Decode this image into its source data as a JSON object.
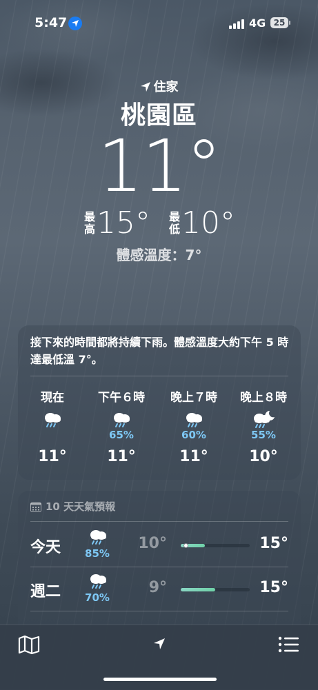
{
  "status_bar": {
    "time": "5:47",
    "network": "4G",
    "battery": "25"
  },
  "location": {
    "label": "住家",
    "city": "桃園區"
  },
  "current": {
    "temperature": "11°",
    "high_label": "最高",
    "high": "15°",
    "low_label": "最低",
    "low": "10°",
    "feels_like": "體感溫度：7°"
  },
  "hourly": {
    "summary": "接下來的時間都將持續下雨。體感溫度大約下午 5 時達最低溫 7°。",
    "items": [
      {
        "label": "現在",
        "icon": "rain-cloud-icon",
        "precip": "",
        "temp": "11°"
      },
      {
        "label": "下午６時",
        "icon": "rain-cloud-icon",
        "precip": "65%",
        "temp": "11°"
      },
      {
        "label": "晚上７時",
        "icon": "rain-cloud-icon",
        "precip": "60%",
        "temp": "11°"
      },
      {
        "label": "晚上８時",
        "icon": "night-rain-cloud-icon",
        "precip": "55%",
        "temp": "10°"
      }
    ]
  },
  "daily": {
    "title": "10 天天氣預報",
    "items": [
      {
        "day": "今天",
        "icon": "rain-cloud-icon",
        "precip": "85%",
        "low": "10°",
        "high": "15°",
        "range_start": 0.0,
        "range_end": 0.35,
        "current_marker": 0.04
      },
      {
        "day": "週二",
        "icon": "rain-cloud-icon",
        "precip": "70%",
        "low": "9°",
        "high": "15°",
        "range_start": 0.0,
        "range_end": 0.5
      }
    ]
  },
  "bottom_bar": {
    "map": "map-icon",
    "location": "location-arrow-icon",
    "list": "list-icon"
  },
  "colors": {
    "precip": "#7ec8f5",
    "range_fill": "#7fd6bd",
    "location_dot": "#1a7cf2"
  }
}
